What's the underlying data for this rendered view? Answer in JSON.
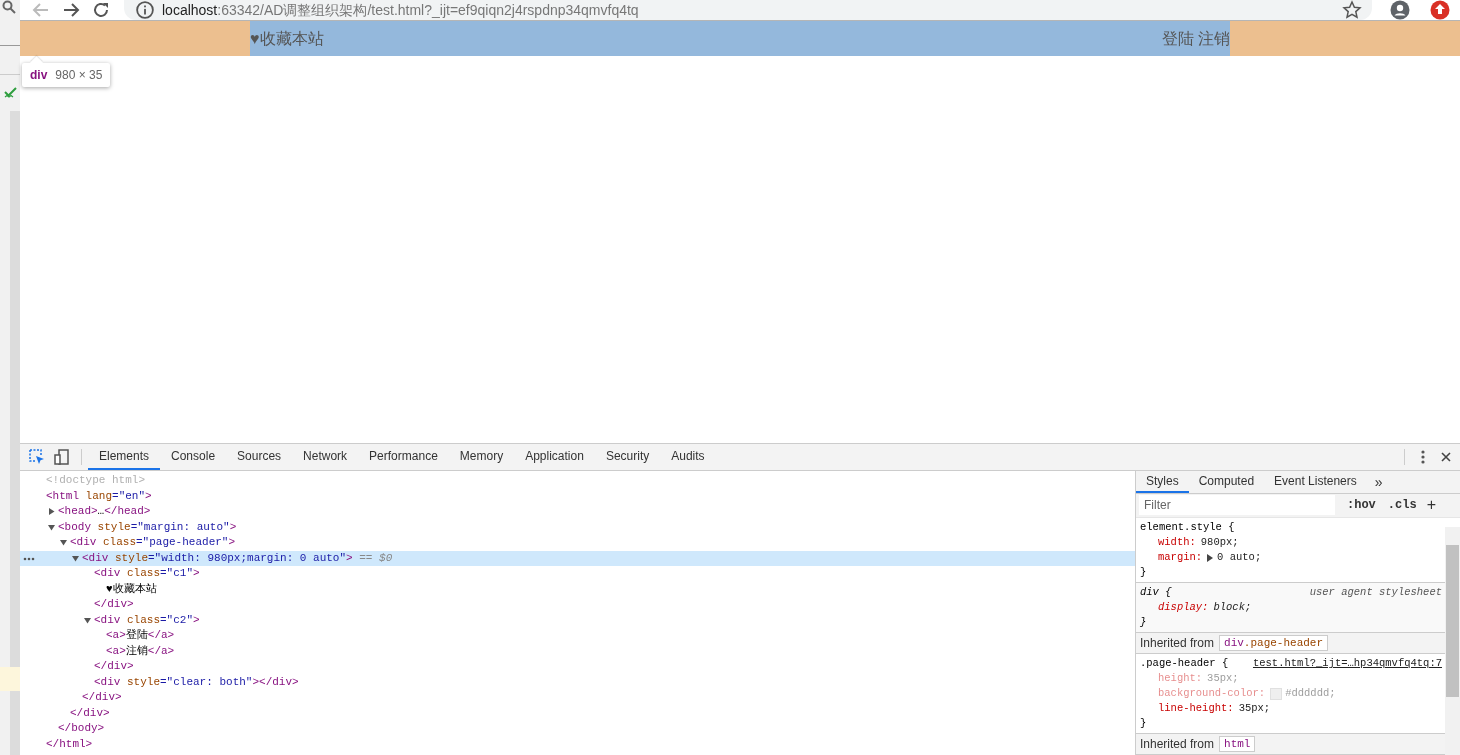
{
  "browser": {
    "url_host": "localhost",
    "url_rest": ":63342/AD调整组织架构/test.html?_ijt=ef9qiqn2j4rspdnp34qmvfq4tq"
  },
  "page": {
    "header_left": "♥收藏本站",
    "header_links": [
      "登陆",
      "注销"
    ]
  },
  "tooltip": {
    "tag": "div",
    "size": "980 × 35"
  },
  "devtools": {
    "tabs": [
      {
        "label": "Elements",
        "selected": true
      },
      {
        "label": "Console",
        "selected": false
      },
      {
        "label": "Sources",
        "selected": false
      },
      {
        "label": "Network",
        "selected": false
      },
      {
        "label": "Performance",
        "selected": false
      },
      {
        "label": "Memory",
        "selected": false
      },
      {
        "label": "Application",
        "selected": false
      },
      {
        "label": "Security",
        "selected": false
      },
      {
        "label": "Audits",
        "selected": false
      }
    ],
    "dom": [
      {
        "kind": "doctype",
        "tokens": [
          {
            "kind": "comment",
            "text": "<!doctype html>"
          }
        ]
      },
      {
        "kind": "root",
        "selected": false,
        "open": [
          {
            "kind": "tag",
            "text": "<html"
          },
          {
            "kind": "attr",
            "text": " lang"
          },
          {
            "kind": "value",
            "text": "=\"en\""
          },
          {
            "kind": "tag",
            "text": ">"
          }
        ],
        "close": [
          {
            "kind": "tag",
            "text": "</html>"
          }
        ],
        "children": [
          {
            "kind": "element",
            "expanded": false,
            "selected": false,
            "open": [
              {
                "kind": "tag",
                "text": "<head>"
              },
              {
                "kind": "text",
                "text": "…"
              },
              {
                "kind": "tag",
                "text": "</head>"
              }
            ]
          },
          {
            "kind": "element",
            "expanded": true,
            "selected": false,
            "open": [
              {
                "kind": "tag",
                "text": "<body"
              },
              {
                "kind": "attr",
                "text": " style"
              },
              {
                "kind": "value",
                "text": "=\"margin: auto\""
              },
              {
                "kind": "tag",
                "text": ">"
              }
            ],
            "close": [
              {
                "kind": "tag",
                "text": "</body>"
              }
            ],
            "children": [
              {
                "kind": "element",
                "expanded": true,
                "selected": false,
                "open": [
                  {
                    "kind": "tag",
                    "text": "<div"
                  },
                  {
                    "kind": "attr",
                    "text": " class"
                  },
                  {
                    "kind": "value",
                    "text": "=\"page-header\""
                  },
                  {
                    "kind": "tag",
                    "text": ">"
                  }
                ],
                "close": [
                  {
                    "kind": "tag",
                    "text": "</div>"
                  }
                ],
                "children": [
                  {
                    "kind": "element",
                    "expanded": true,
                    "selected": true,
                    "open": [
                      {
                        "kind": "tag",
                        "text": "<div"
                      },
                      {
                        "kind": "attr",
                        "text": " style"
                      },
                      {
                        "kind": "value",
                        "text": "=\"width: 980px;margin: 0 auto\""
                      },
                      {
                        "kind": "tag",
                        "text": ">"
                      },
                      {
                        "kind": "marker",
                        "text": " == $0"
                      }
                    ],
                    "close": [
                      {
                        "kind": "tag",
                        "text": "</div>"
                      }
                    ],
                    "children": [
                      {
                        "kind": "leaf",
                        "selected": false,
                        "open": [
                          {
                            "kind": "tag",
                            "text": "<div"
                          },
                          {
                            "kind": "attr",
                            "text": " class"
                          },
                          {
                            "kind": "value",
                            "text": "=\"c1\""
                          },
                          {
                            "kind": "tag",
                            "text": ">"
                          }
                        ],
                        "children": [
                          {
                            "kind": "textnode",
                            "tokens": [
                              {
                                "kind": "text",
                                "text": "♥收藏本站"
                              }
                            ]
                          }
                        ],
                        "close": [
                          {
                            "kind": "tag",
                            "text": "</div>"
                          }
                        ]
                      },
                      {
                        "kind": "element",
                        "expanded": true,
                        "selected": false,
                        "open": [
                          {
                            "kind": "tag",
                            "text": "<div"
                          },
                          {
                            "kind": "attr",
                            "text": " class"
                          },
                          {
                            "kind": "value",
                            "text": "=\"c2\""
                          },
                          {
                            "kind": "tag",
                            "text": ">"
                          }
                        ],
                        "close": [
                          {
                            "kind": "tag",
                            "text": "</div>"
                          }
                        ],
                        "children": [
                          {
                            "kind": "inline",
                            "selected": false,
                            "open": [
                              {
                                "kind": "tag",
                                "text": "<a>"
                              },
                              {
                                "kind": "text",
                                "text": "登陆"
                              },
                              {
                                "kind": "tag",
                                "text": "</a>"
                              }
                            ]
                          },
                          {
                            "kind": "inline",
                            "selected": false,
                            "open": [
                              {
                                "kind": "tag",
                                "text": "<a>"
                              },
                              {
                                "kind": "text",
                                "text": "注销"
                              },
                              {
                                "kind": "tag",
                                "text": "</a>"
                              }
                            ]
                          }
                        ]
                      },
                      {
                        "kind": "inline",
                        "selected": false,
                        "open": [
                          {
                            "kind": "tag",
                            "text": "<div"
                          },
                          {
                            "kind": "attr",
                            "text": " style"
                          },
                          {
                            "kind": "value",
                            "text": "=\"clear: both\""
                          },
                          {
                            "kind": "tag",
                            "text": "></div>"
                          }
                        ]
                      }
                    ]
                  }
                ]
              }
            ]
          }
        ]
      }
    ],
    "styles": {
      "tabs": [
        {
          "label": "Styles",
          "selected": true
        },
        {
          "label": "Computed",
          "selected": false
        },
        {
          "label": "Event Listeners",
          "selected": false
        }
      ],
      "more": "»",
      "filter": {
        "placeholder": "Filter"
      },
      "toggles": [
        ":hov",
        ".cls"
      ],
      "add": "+",
      "sections": [
        {
          "kind": "rule",
          "user_agent": false,
          "selector": "element.style {",
          "properties": [
            {
              "name": "width:",
              "value": "980px;",
              "inactive": false,
              "expander": false
            },
            {
              "name": "margin:",
              "value": "0 auto;",
              "inactive": false,
              "expander": true
            }
          ],
          "close": "}"
        },
        {
          "kind": "rule",
          "user_agent": true,
          "selector": "div {",
          "origin": "user agent stylesheet",
          "properties": [
            {
              "name": "display:",
              "value": "block;",
              "inactive": false,
              "expander": false
            }
          ],
          "close": "}"
        },
        {
          "kind": "inherited",
          "label": "Inherited from",
          "tag": "div",
          "cls": ".page-header"
        },
        {
          "kind": "rule",
          "user_agent": false,
          "selector": ".page-header {",
          "link": "test.html?_ijt=…hp34qmvfq4tq:7",
          "properties": [
            {
              "name": "height:",
              "value": "35px;",
              "inactive": true,
              "expander": false
            },
            {
              "name": "background-color:",
              "value": "#dddddd;",
              "inactive": true,
              "expander": false,
              "swatch": true
            },
            {
              "name": "line-height:",
              "value": "35px;",
              "inactive": false,
              "expander": false
            }
          ],
          "close": "}"
        },
        {
          "kind": "inherited",
          "label": "Inherited from",
          "tag": "html"
        }
      ]
    }
  }
}
